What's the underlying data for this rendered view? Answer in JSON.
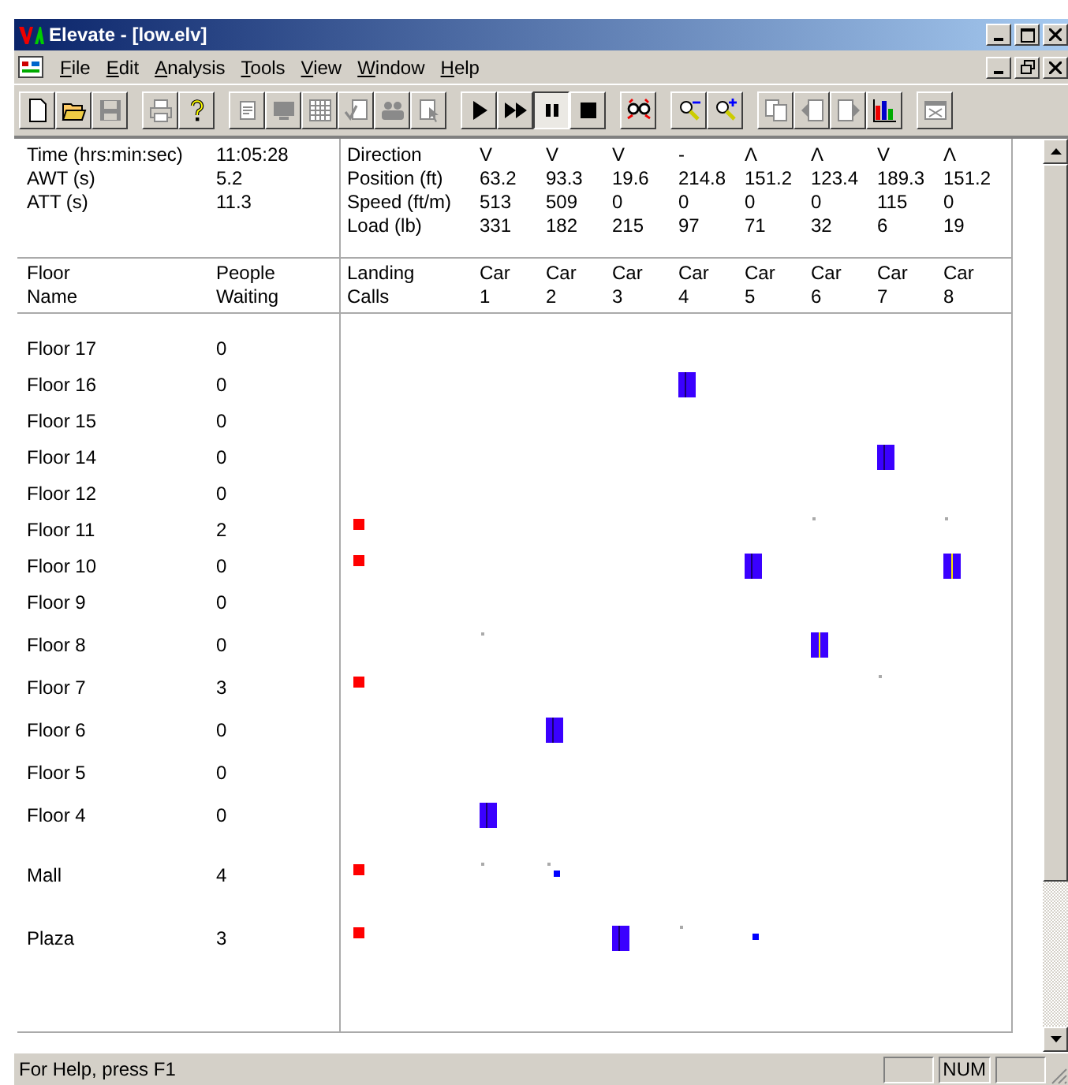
{
  "window": {
    "title": "Elevate - [low.elv]"
  },
  "menu": [
    "File",
    "Edit",
    "Analysis",
    "Tools",
    "View",
    "Window",
    "Help"
  ],
  "toolbar": [
    [
      {
        "kind": "new",
        "disabled": false,
        "pressed": false
      },
      {
        "kind": "open",
        "disabled": false,
        "pressed": false
      },
      {
        "kind": "save",
        "disabled": true,
        "pressed": false
      }
    ],
    [
      {
        "kind": "print",
        "disabled": true,
        "pressed": false
      },
      {
        "kind": "help",
        "disabled": false,
        "pressed": false
      }
    ],
    [
      {
        "kind": "form",
        "disabled": true,
        "pressed": false
      },
      {
        "kind": "monitor",
        "disabled": true,
        "pressed": false
      },
      {
        "kind": "grid",
        "disabled": true,
        "pressed": false
      },
      {
        "kind": "check",
        "disabled": true,
        "pressed": false
      },
      {
        "kind": "people",
        "disabled": true,
        "pressed": false
      },
      {
        "kind": "pointer",
        "disabled": true,
        "pressed": false
      }
    ],
    [
      {
        "kind": "play",
        "disabled": false,
        "pressed": false
      },
      {
        "kind": "fast",
        "disabled": false,
        "pressed": false
      },
      {
        "kind": "pause",
        "disabled": false,
        "pressed": true
      },
      {
        "kind": "stop",
        "disabled": false,
        "pressed": false
      }
    ],
    [
      {
        "kind": "glasses",
        "disabled": false,
        "pressed": false
      }
    ],
    [
      {
        "kind": "zoomout",
        "disabled": false,
        "pressed": false
      },
      {
        "kind": "zoomin",
        "disabled": false,
        "pressed": false
      }
    ],
    [
      {
        "kind": "copy",
        "disabled": true,
        "pressed": false
      },
      {
        "kind": "back",
        "disabled": true,
        "pressed": false
      },
      {
        "kind": "forward",
        "disabled": true,
        "pressed": false
      },
      {
        "kind": "chart",
        "disabled": false,
        "pressed": false
      }
    ],
    [
      {
        "kind": "window",
        "disabled": true,
        "pressed": false
      }
    ]
  ],
  "stats": [
    {
      "label": "Time (hrs:min:sec)",
      "value": "11:05:28"
    },
    {
      "label": "AWT (s)",
      "value": "5.2"
    },
    {
      "label": "ATT (s)",
      "value": "11.3"
    }
  ],
  "car_stats": [
    {
      "label": "Direction",
      "values": [
        "V",
        "V",
        "V",
        "-",
        "Λ",
        "Λ",
        "V",
        "Λ"
      ]
    },
    {
      "label": "Position (ft)",
      "values": [
        "63.2",
        "93.3",
        "19.6",
        "214.8",
        "151.2",
        "123.4",
        "189.3",
        "151.2"
      ]
    },
    {
      "label": "Speed (ft/m)",
      "values": [
        "513",
        "509",
        "0",
        "0",
        "0",
        "0",
        "115",
        "0"
      ]
    },
    {
      "label": "Load (lb)",
      "values": [
        "331",
        "182",
        "215",
        "97",
        "71",
        "32",
        "6",
        "19"
      ]
    }
  ],
  "columns": {
    "floor": [
      "Floor",
      "Name"
    ],
    "waiting": [
      "People",
      "Waiting"
    ],
    "landing": [
      "Landing",
      "Calls"
    ],
    "cars": [
      [
        "Car",
        "1"
      ],
      [
        "Car",
        "2"
      ],
      [
        "Car",
        "3"
      ],
      [
        "Car",
        "4"
      ],
      [
        "Car",
        "5"
      ],
      [
        "Car",
        "6"
      ],
      [
        "Car",
        "7"
      ],
      [
        "Car",
        "8"
      ]
    ]
  },
  "floors": [
    {
      "name": "Floor 17",
      "waiting": "0",
      "landing_call": false,
      "cars": [
        {
          "kind": "empty"
        },
        {
          "kind": "empty"
        },
        {
          "kind": "empty"
        },
        {
          "kind": "empty"
        },
        {
          "kind": "empty"
        },
        {
          "kind": "empty"
        },
        {
          "kind": "empty"
        },
        {
          "kind": "empty"
        }
      ]
    },
    {
      "name": "Floor 16",
      "waiting": "0",
      "landing_call": false,
      "cars": [
        {
          "kind": "empty"
        },
        {
          "kind": "empty"
        },
        {
          "kind": "empty"
        },
        {
          "kind": "car"
        },
        {
          "kind": "empty"
        },
        {
          "kind": "empty"
        },
        {
          "kind": "empty"
        },
        {
          "kind": "empty"
        }
      ]
    },
    {
      "name": "Floor 15",
      "waiting": "0",
      "landing_call": false,
      "cars": [
        {
          "kind": "empty"
        },
        {
          "kind": "empty"
        },
        {
          "kind": "empty"
        },
        {
          "kind": "empty"
        },
        {
          "kind": "empty"
        },
        {
          "kind": "empty"
        },
        {
          "kind": "empty"
        },
        {
          "kind": "empty"
        }
      ]
    },
    {
      "name": "Floor 14",
      "waiting": "0",
      "landing_call": false,
      "cars": [
        {
          "kind": "empty"
        },
        {
          "kind": "empty"
        },
        {
          "kind": "empty"
        },
        {
          "kind": "empty"
        },
        {
          "kind": "empty"
        },
        {
          "kind": "empty"
        },
        {
          "kind": "car"
        },
        {
          "kind": "empty"
        }
      ]
    },
    {
      "name": "Floor 12",
      "waiting": "0",
      "landing_call": false,
      "cars": [
        {
          "kind": "empty"
        },
        {
          "kind": "empty"
        },
        {
          "kind": "empty"
        },
        {
          "kind": "empty"
        },
        {
          "kind": "empty"
        },
        {
          "kind": "empty"
        },
        {
          "kind": "empty"
        },
        {
          "kind": "empty"
        }
      ]
    },
    {
      "name": "Floor 11",
      "waiting": "2",
      "landing_call": true,
      "cars": [
        {
          "kind": "empty"
        },
        {
          "kind": "empty"
        },
        {
          "kind": "empty"
        },
        {
          "kind": "empty"
        },
        {
          "kind": "empty"
        },
        {
          "kind": "dot"
        },
        {
          "kind": "empty"
        },
        {
          "kind": "dot"
        }
      ]
    },
    {
      "name": "Floor 10",
      "waiting": "0",
      "landing_call": true,
      "cars": [
        {
          "kind": "empty"
        },
        {
          "kind": "empty"
        },
        {
          "kind": "empty"
        },
        {
          "kind": "empty"
        },
        {
          "kind": "car"
        },
        {
          "kind": "empty"
        },
        {
          "kind": "empty"
        },
        {
          "kind": "car_doors"
        }
      ]
    },
    {
      "name": "Floor 9",
      "waiting": "0",
      "landing_call": false,
      "cars": [
        {
          "kind": "empty"
        },
        {
          "kind": "empty"
        },
        {
          "kind": "empty"
        },
        {
          "kind": "empty"
        },
        {
          "kind": "empty"
        },
        {
          "kind": "empty"
        },
        {
          "kind": "empty"
        },
        {
          "kind": "empty"
        }
      ]
    },
    {
      "name": "Floor 8",
      "waiting": "0",
      "landing_call": false,
      "cars": [
        {
          "kind": "dot"
        },
        {
          "kind": "empty"
        },
        {
          "kind": "empty"
        },
        {
          "kind": "empty"
        },
        {
          "kind": "empty"
        },
        {
          "kind": "car_doors"
        },
        {
          "kind": "empty"
        },
        {
          "kind": "empty"
        }
      ]
    },
    {
      "name": "Floor 7",
      "waiting": "3",
      "landing_call": true,
      "cars": [
        {
          "kind": "empty"
        },
        {
          "kind": "empty"
        },
        {
          "kind": "empty"
        },
        {
          "kind": "empty"
        },
        {
          "kind": "empty"
        },
        {
          "kind": "empty"
        },
        {
          "kind": "dot"
        },
        {
          "kind": "empty"
        }
      ]
    },
    {
      "name": "Floor 6",
      "waiting": "0",
      "landing_call": false,
      "cars": [
        {
          "kind": "empty"
        },
        {
          "kind": "car"
        },
        {
          "kind": "empty"
        },
        {
          "kind": "empty"
        },
        {
          "kind": "empty"
        },
        {
          "kind": "empty"
        },
        {
          "kind": "empty"
        },
        {
          "kind": "empty"
        }
      ]
    },
    {
      "name": "Floor 5",
      "waiting": "0",
      "landing_call": false,
      "cars": [
        {
          "kind": "empty"
        },
        {
          "kind": "empty"
        },
        {
          "kind": "empty"
        },
        {
          "kind": "empty"
        },
        {
          "kind": "empty"
        },
        {
          "kind": "empty"
        },
        {
          "kind": "empty"
        },
        {
          "kind": "empty"
        }
      ]
    },
    {
      "name": "Floor 4",
      "waiting": "0",
      "landing_call": false,
      "cars": [
        {
          "kind": "car"
        },
        {
          "kind": "empty"
        },
        {
          "kind": "empty"
        },
        {
          "kind": "empty"
        },
        {
          "kind": "empty"
        },
        {
          "kind": "empty"
        },
        {
          "kind": "empty"
        },
        {
          "kind": "empty"
        }
      ]
    },
    {
      "name": "Mall",
      "waiting": "4",
      "landing_call": true,
      "cars": [
        {
          "kind": "dot"
        },
        {
          "kind": "dot_call"
        },
        {
          "kind": "empty"
        },
        {
          "kind": "empty"
        },
        {
          "kind": "empty"
        },
        {
          "kind": "empty"
        },
        {
          "kind": "empty"
        },
        {
          "kind": "empty"
        }
      ]
    },
    {
      "name": "Plaza",
      "waiting": "3",
      "landing_call": true,
      "cars": [
        {
          "kind": "empty"
        },
        {
          "kind": "empty"
        },
        {
          "kind": "car"
        },
        {
          "kind": "dot"
        },
        {
          "kind": "call"
        },
        {
          "kind": "empty"
        },
        {
          "kind": "empty"
        },
        {
          "kind": "empty"
        }
      ]
    }
  ],
  "status_bar": {
    "text": "For Help, press F1",
    "panes": [
      "NUM"
    ]
  }
}
